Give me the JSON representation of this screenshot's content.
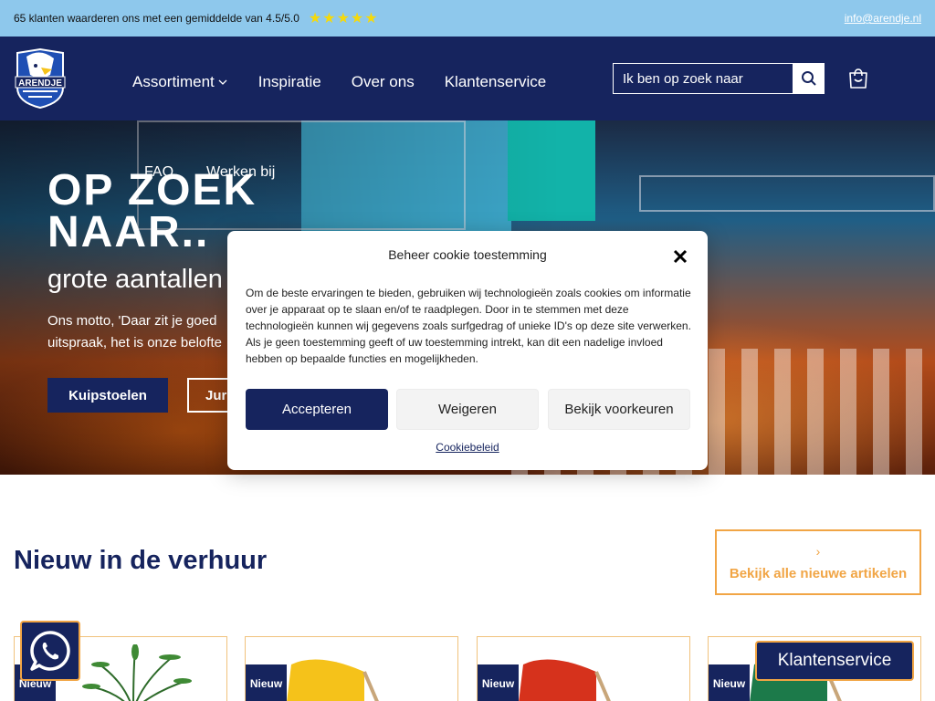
{
  "topbar": {
    "rating_text": "65 klanten waarderen ons met een gemiddelde van 4.5/5.0",
    "stars": "★★★★★",
    "email": "info@arendje.nl"
  },
  "header": {
    "logo_text": "ARENDJE",
    "nav": [
      {
        "label": "Assortiment"
      },
      {
        "label": "Inspiratie"
      },
      {
        "label": "Over ons"
      },
      {
        "label": "Klantenservice"
      }
    ],
    "search_placeholder": "Ik ben op zoek naar",
    "icons": {
      "search": "search-icon",
      "cart": "cart-icon",
      "dropdown": "chevron-down-icon"
    }
  },
  "hero": {
    "faq": "FAQ",
    "werken": "Werken bij",
    "title_line1": "OP ZOEK",
    "title_line2": "NAAR..",
    "subtitle": "grote aantallen",
    "text_line1": "Ons motto, 'Daar zit je goed",
    "text_line2": "uitspraak, het is onze belofte",
    "btn_primary": "Kuipstoelen",
    "btn_secondary": "Jur"
  },
  "cookie": {
    "title": "Beheer cookie toestemming",
    "body": "Om de beste ervaringen te bieden, gebruiken wij technologieën zoals cookies om informatie over je apparaat op te slaan en/of te raadplegen. Door in te stemmen met deze technologieën kunnen wij gegevens zoals surfgedrag of unieke ID's op deze site verwerken. Als je geen toestemming geeft of uw toestemming intrekt, kan dit een nadelige invloed hebben op bepaalde functies en mogelijkheden.",
    "accept": "Accepteren",
    "deny": "Weigeren",
    "prefs": "Bekijk voorkeuren",
    "policy": "Cookiebeleid"
  },
  "new_section": {
    "title": "Nieuw in de verhuur",
    "view_all": "Bekijk alle nieuwe artikelen",
    "chevron": "›",
    "cards": [
      {
        "badge": "Nieuw",
        "image": "plant"
      },
      {
        "badge": "Nieuw",
        "image": "yellow-beach-chair"
      },
      {
        "badge": "Nieuw",
        "image": "red-beach-chair"
      },
      {
        "badge": "Nieuw",
        "image": "green-beach-chair"
      }
    ]
  },
  "floating": {
    "whatsapp_icon": "whatsapp-icon",
    "klantenservice": "Klantenservice"
  },
  "colors": {
    "navy": "#16245e",
    "accent": "#f1a545",
    "topbar": "#8ec8ec",
    "stars": "#f5d90a"
  }
}
